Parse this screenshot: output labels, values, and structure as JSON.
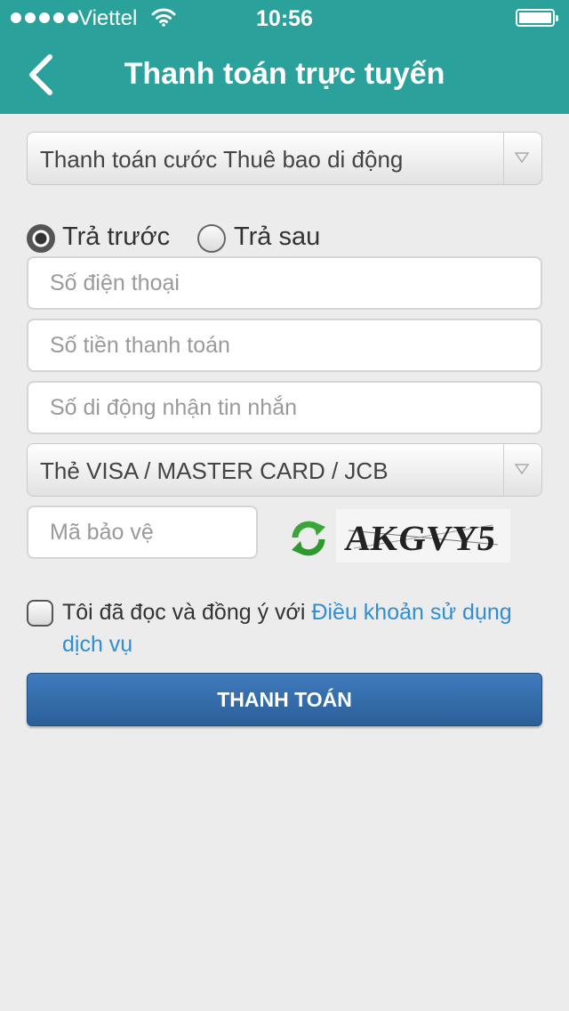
{
  "status_bar": {
    "carrier": "Viettel",
    "time": "10:56"
  },
  "header": {
    "title": "Thanh toán trực tuyến",
    "bg_color": "#2aa19a"
  },
  "form": {
    "service_select": {
      "selected": "Thanh toán cước Thuê bao di động"
    },
    "subscription_type": {
      "options": [
        "Trả trước",
        "Trả sau"
      ],
      "selected": "Trả trước"
    },
    "phone_placeholder": "Số điện thoại",
    "amount_placeholder": "Số tiền thanh toán",
    "sms_phone_placeholder": "Số di động nhận tin nhắn",
    "card_select": {
      "selected": "Thẻ VISA / MASTER CARD / JCB"
    },
    "captcha_placeholder": "Mã bảo vệ",
    "captcha_text": "AKGVY5",
    "agree_text": "Tôi đã đọc và đồng ý với ",
    "terms_link": "Điều khoản sử dụng dịch vụ",
    "terms_checked": false,
    "submit_label": "THANH TOÁN",
    "link_color": "#2f8fd1",
    "button_color": "#2f67a4"
  }
}
